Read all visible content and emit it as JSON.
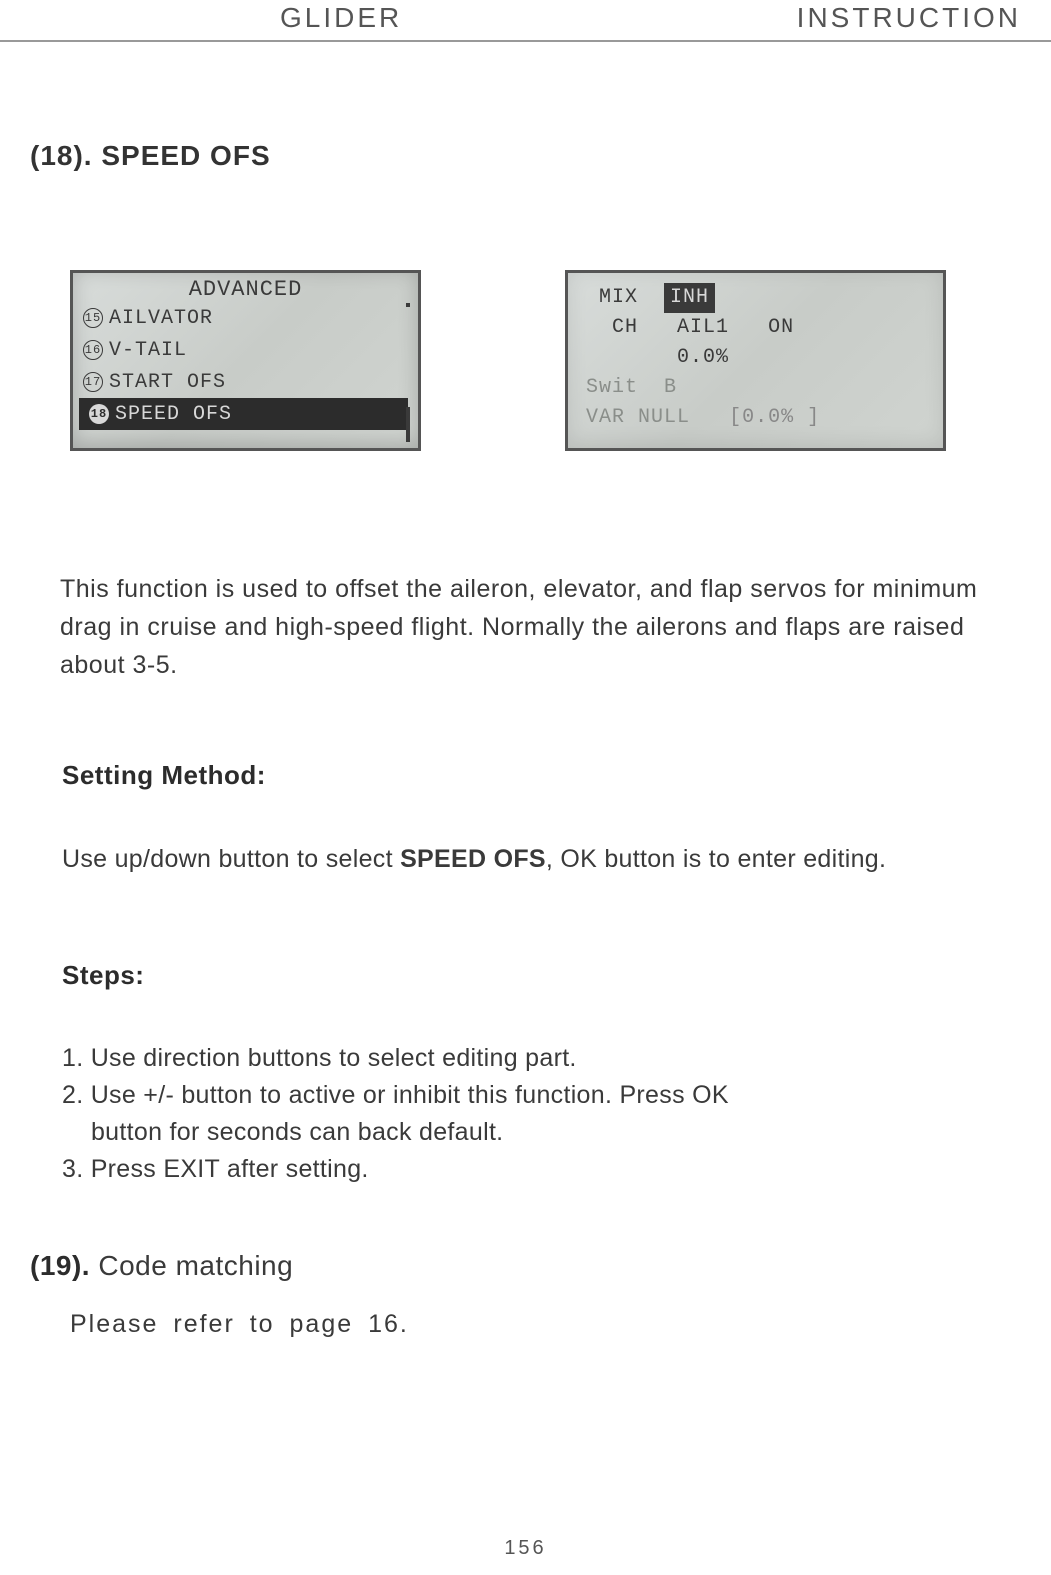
{
  "header": {
    "left": "GLIDER",
    "right": "INSTRUCTION"
  },
  "section18": {
    "title": "(18). SPEED OFS",
    "lcd_left": {
      "title": "ADVANCED",
      "items": [
        {
          "num": "15",
          "label": "AILVATOR",
          "selected": false
        },
        {
          "num": "16",
          "label": "V-TAIL",
          "selected": false
        },
        {
          "num": "17",
          "label": "START OFS",
          "selected": false
        },
        {
          "num": "18",
          "label": "SPEED OFS",
          "selected": true
        }
      ]
    },
    "lcd_right": {
      "line1_a": "MIX",
      "line1_b": "INH",
      "line2_a": "CH",
      "line2_b": "AIL1",
      "line2_c": "ON",
      "line3": "0.0%",
      "line4_a": "Swit",
      "line4_b": "B",
      "line5_a": "VAR",
      "line5_b": "NULL",
      "line5_c": "[0.0%   ]"
    },
    "description": "This function is used to offset the aileron, elevator, and flap servos for minimum drag in cruise and high-speed flight. Normally the ailerons and flaps are raised about 3-5.",
    "setting_method_label": "Setting Method:",
    "use_updown_a": "Use up/down button to select ",
    "use_updown_b": "SPEED OFS",
    "use_updown_c": ", OK button is to enter editing.",
    "steps_label": "Steps:",
    "steps": [
      "1. Use direction buttons to select editing part.",
      "2. Use +/- button to active or inhibit this function. Press OK",
      "    button for seconds can back default.",
      "3. Press EXIT after setting."
    ]
  },
  "section19": {
    "prefix": "(19). ",
    "title": "Code matching",
    "refer": "Please refer to page 16."
  },
  "page_number": "156"
}
